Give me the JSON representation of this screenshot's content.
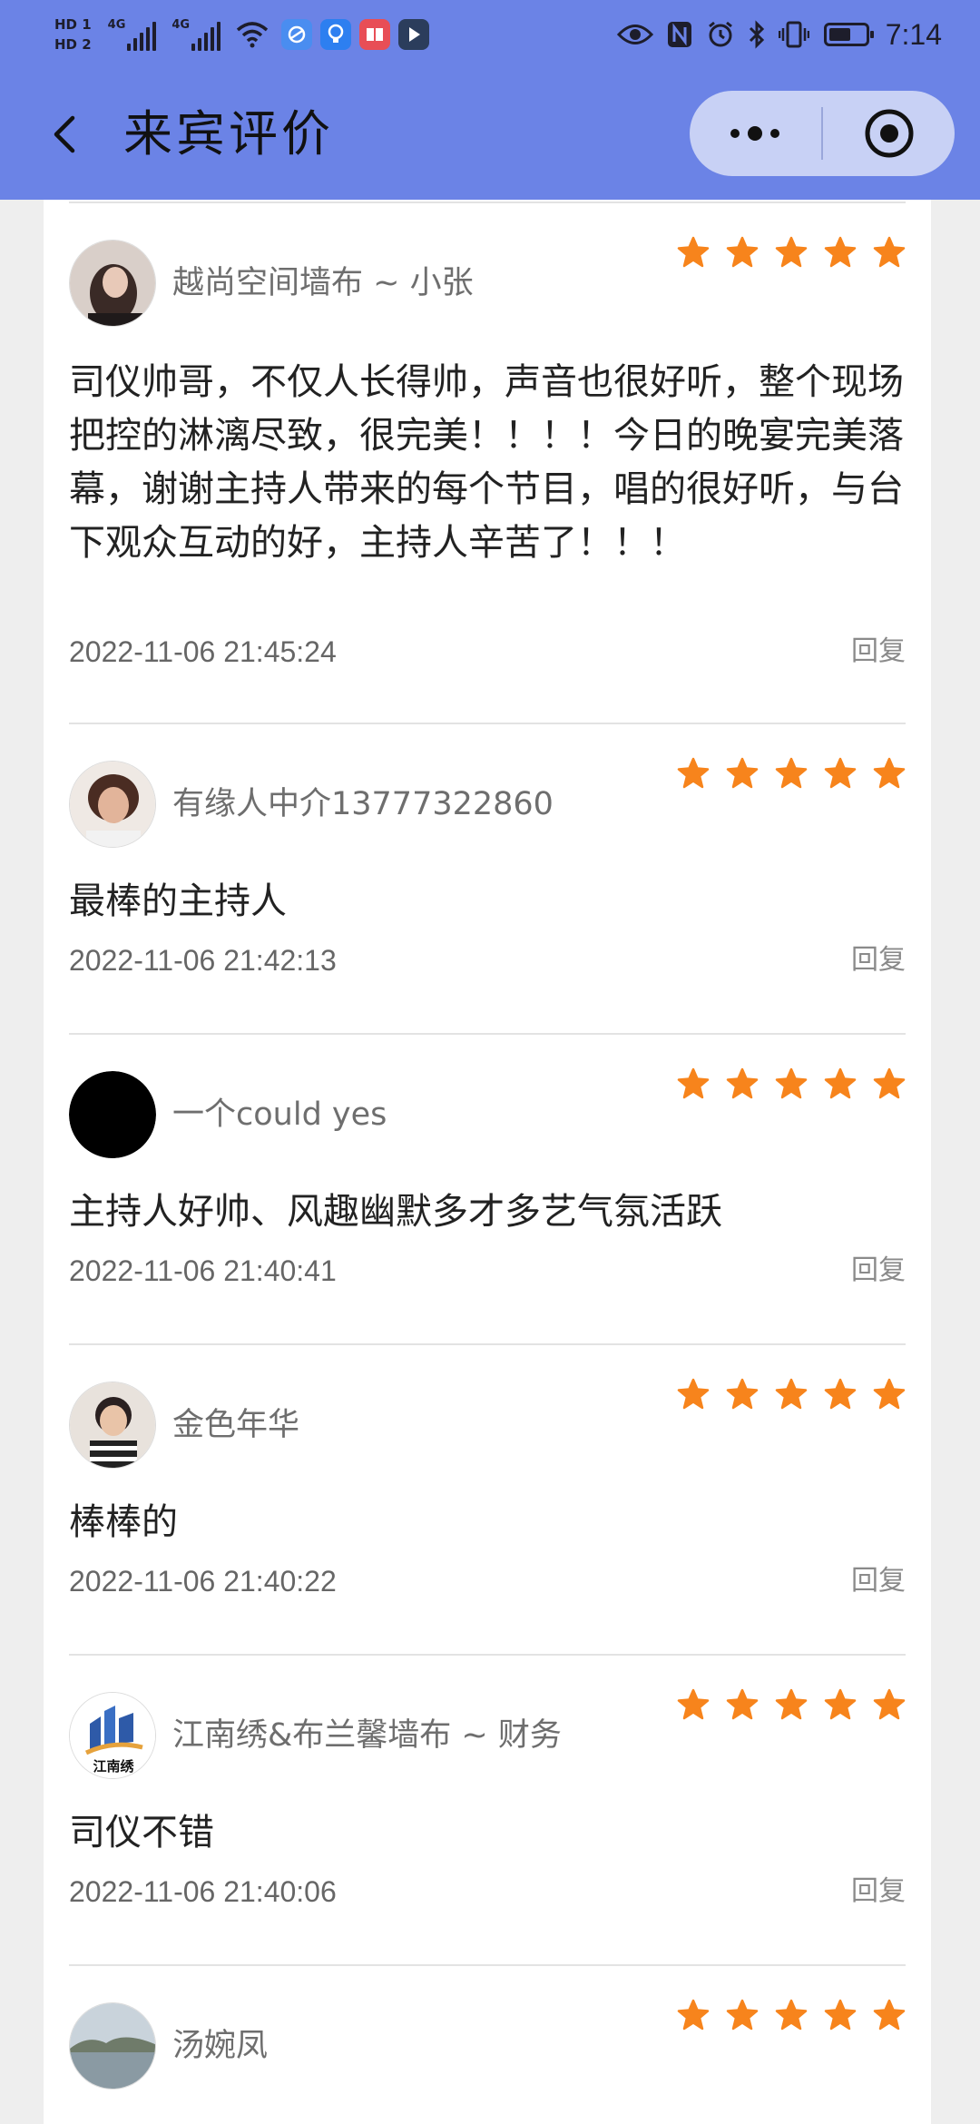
{
  "status_bar": {
    "sim1": "HD 1",
    "sim2": "HD 2",
    "net1": "4G",
    "net2": "4G",
    "time": "7:14",
    "battery_level": 0.6,
    "left_icons": [
      "browser-app-icon",
      "bulb-app-icon",
      "book-app-icon",
      "play-app-icon"
    ],
    "right_icons": [
      "eye-icon",
      "nfc-icon",
      "alarm-icon",
      "bluetooth-icon",
      "vibrate-icon",
      "battery-icon"
    ]
  },
  "header": {
    "title": "来宾评价",
    "accent_color": "#6b83e6"
  },
  "reviews": [
    {
      "name": "越尚空间墙布 ~ 小张",
      "avatar": "woman-photo-avatar",
      "stars": 5,
      "content": "司仪帅哥，不仅人长得帅，声音也很好听，整个现场把控的淋漓尽致，很完美！！！！今日的晚宴完美落幕，谢谢主持人带来的每个节目，唱的很好听，与台下观众互动的好，主持人辛苦了！！！",
      "time": "2022-11-06 21:45:24",
      "reply": "回复"
    },
    {
      "name": "有缘人中介13777322860",
      "avatar": "woman-portrait-avatar",
      "stars": 5,
      "content": "最棒的主持人",
      "time": "2022-11-06 21:42:13",
      "reply": "回复"
    },
    {
      "name": "一个could yes",
      "avatar": "black-circle-avatar",
      "stars": 5,
      "content": "主持人好帅、风趣幽默多才多艺气氛活跃",
      "time": "2022-11-06 21:40:41",
      "reply": "回复"
    },
    {
      "name": "金色年华",
      "avatar": "child-photo-avatar",
      "stars": 5,
      "content": "棒棒的",
      "time": "2022-11-06 21:40:22",
      "reply": "回复"
    },
    {
      "name": "江南绣&布兰馨墙布 ~ 财务",
      "avatar": "logo-avatar",
      "avatar_text": "江南绣",
      "stars": 5,
      "content": "司仪不错",
      "time": "2022-11-06 21:40:06",
      "reply": "回复"
    },
    {
      "name": "汤婉凤",
      "avatar": "lake-photo-avatar",
      "stars": 5,
      "content": "",
      "time": "",
      "reply": ""
    }
  ],
  "star_color": "#f7841c"
}
